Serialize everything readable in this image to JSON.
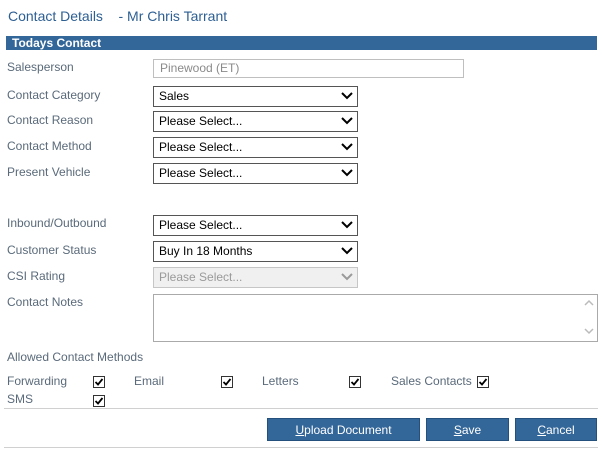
{
  "header": {
    "title": "Contact Details",
    "subtitle": "- Mr Chris Tarrant"
  },
  "section": {
    "title": "Todays Contact"
  },
  "form": {
    "salesperson": {
      "label": "Salesperson",
      "value": "Pinewood (ET)"
    },
    "contact_category": {
      "label": "Contact Category",
      "value": "Sales"
    },
    "contact_reason": {
      "label": "Contact Reason",
      "value": "Please Select..."
    },
    "contact_method": {
      "label": "Contact Method",
      "value": "Please Select..."
    },
    "present_vehicle": {
      "label": "Present Vehicle",
      "value": "Please Select..."
    },
    "inbound_outbound": {
      "label": "Inbound/Outbound",
      "value": "Please Select..."
    },
    "customer_status": {
      "label": "Customer Status",
      "value": "Buy In 18 Months"
    },
    "csi_rating": {
      "label": "CSI Rating",
      "value": "Please Select..."
    },
    "contact_notes": {
      "label": "Contact Notes",
      "value": ""
    }
  },
  "allowed": {
    "label": "Allowed Contact Methods",
    "items": [
      {
        "label": "Forwarding",
        "checked": true
      },
      {
        "label": "Email",
        "checked": true
      },
      {
        "label": "Letters",
        "checked": true
      },
      {
        "label": "Sales Contacts",
        "checked": true
      },
      {
        "label": "SMS",
        "checked": true
      }
    ]
  },
  "buttons": {
    "upload": {
      "first": "U",
      "rest": "pload Document"
    },
    "save": {
      "first": "S",
      "rest": "ave"
    },
    "cancel": {
      "first": "C",
      "rest": "ancel"
    }
  },
  "colors": {
    "accent": "#336699",
    "label": "#5a6a7a"
  },
  "icons": {
    "dropdown": "chevron-down-icon",
    "check": "checkmark-icon"
  }
}
